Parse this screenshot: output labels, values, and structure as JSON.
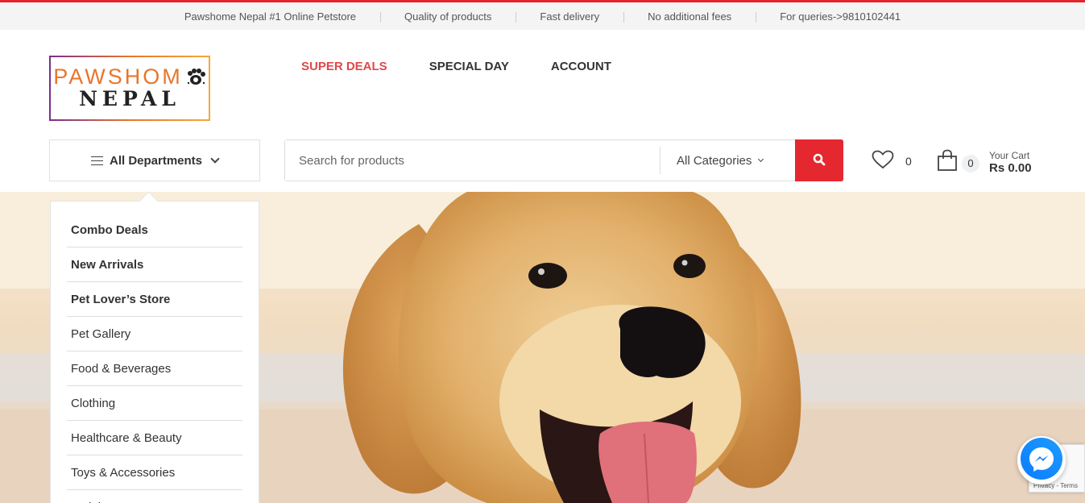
{
  "topbar": {
    "items": [
      "Pawshome Nepal #1 Online Petstore",
      "Quality of products",
      "Fast delivery",
      "No additional fees",
      "For queries->9810102441"
    ]
  },
  "logo": {
    "line1": "PAWSHOM",
    "line2": "NEPAL"
  },
  "nav": {
    "links": [
      "SUPER DEALS",
      "SPECIAL DAY",
      "ACCOUNT"
    ]
  },
  "departments": {
    "button_label": "All Departments",
    "items": [
      "Combo Deals",
      "New Arrivals",
      "Pet Lover’s Store",
      "Pet Gallery",
      "Food & Beverages",
      "Clothing",
      "Healthcare & Beauty",
      "Toys & Accessories",
      "Trainings"
    ]
  },
  "search": {
    "placeholder": "Search for products",
    "category_selected": "All Categories"
  },
  "wishlist": {
    "count": "0"
  },
  "cart": {
    "count": "0",
    "label": "Your Cart",
    "total": "Rs 0.00"
  },
  "recaptcha": {
    "text": "Privacy - Terms"
  },
  "colors": {
    "accent": "#e5272f",
    "nav_active": "#e04848"
  },
  "icons": [
    "hamburger-icon",
    "chevron-down-icon",
    "search-icon",
    "heart-icon",
    "shopping-bag-icon",
    "messenger-icon",
    "paw-icon"
  ]
}
